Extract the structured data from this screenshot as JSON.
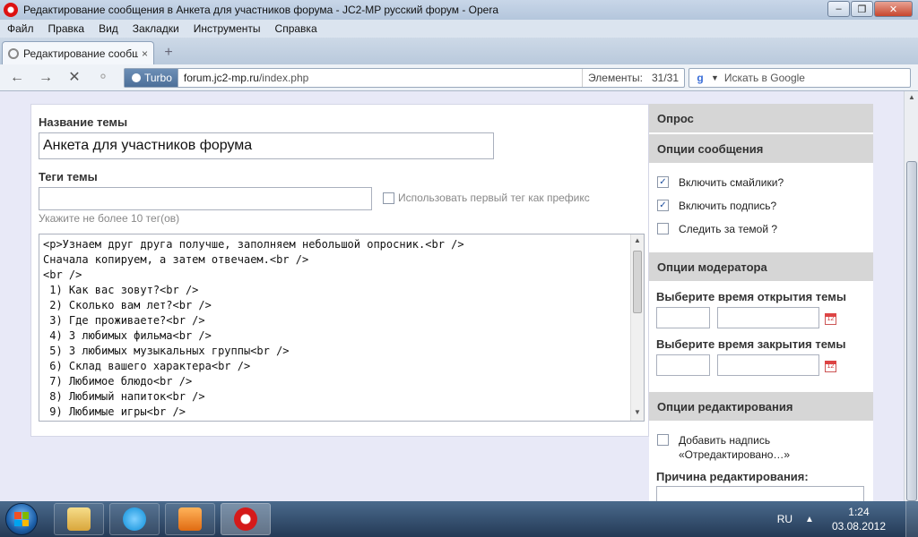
{
  "window": {
    "title": "Редактирование сообщения в Анкета для участников форума - JC2-MP русский форум - Opera",
    "minimize": "–",
    "maximize": "❐",
    "close": "✕"
  },
  "menu": [
    "Файл",
    "Правка",
    "Вид",
    "Закладки",
    "Инструменты",
    "Справка"
  ],
  "tab": {
    "label": "Редактирование сообще…",
    "close": "×",
    "new_tab": "+"
  },
  "address": {
    "turbo": "Turbo",
    "url_host": "forum.jc2-mp.ru",
    "url_path": "/index.php",
    "elements_label": "Элементы:",
    "elements_count": "31/31"
  },
  "search": {
    "engine": "g",
    "placeholder": "Искать в Google"
  },
  "form": {
    "topic_title_label": "Название темы",
    "topic_title_value": "Анкета для участников форума",
    "tags_label": "Теги темы",
    "tags_value": "",
    "prefix_label": "Использовать первый тег как префикс",
    "tags_hint": "Укажите не более 10 тег(ов)",
    "editor_lines": [
      "<p>Узнаем друг друга получше, заполняем небольшой опросник.<br />",
      "Сначала копируем, а затем отвечаем.<br />",
      "<br />",
      " 1) Как вас зовут?<br />",
      " 2) Сколько вам лет?<br />",
      " 3) Где проживаете?<br />",
      " 4) 3 любимых фильма<br />",
      " 5) 3 любимых музыкальных группы<br />",
      " 6) Склад вашего характера<br />",
      " 7) Любимое блюдо<br />",
      " 8) Любимый напиток<br />",
      " 9) Любимые игры<br />"
    ]
  },
  "sidebar": {
    "poll": "Опрос",
    "message_options": "Опции сообщения",
    "options": [
      {
        "label": "Включить смайлики?",
        "checked": true
      },
      {
        "label": "Включить подпись?",
        "checked": true
      },
      {
        "label": "Следить за темой ?",
        "checked": false
      }
    ],
    "moderator_options": "Опции модератора",
    "open_time_label": "Выберите время открытия темы",
    "close_time_label": "Выберите время закрытия темы",
    "edit_options": "Опции редактирования",
    "add_note_line1": "Добавить надпись",
    "add_note_line2": "«Отредактировано…»",
    "edit_reason_label": "Причина редактирования:",
    "calendar_day": "12",
    "check_mark": "✓"
  },
  "taskbar": {
    "language": "RU",
    "time": "1:24",
    "date": "03.08.2012",
    "tray_arrow": "▲"
  }
}
